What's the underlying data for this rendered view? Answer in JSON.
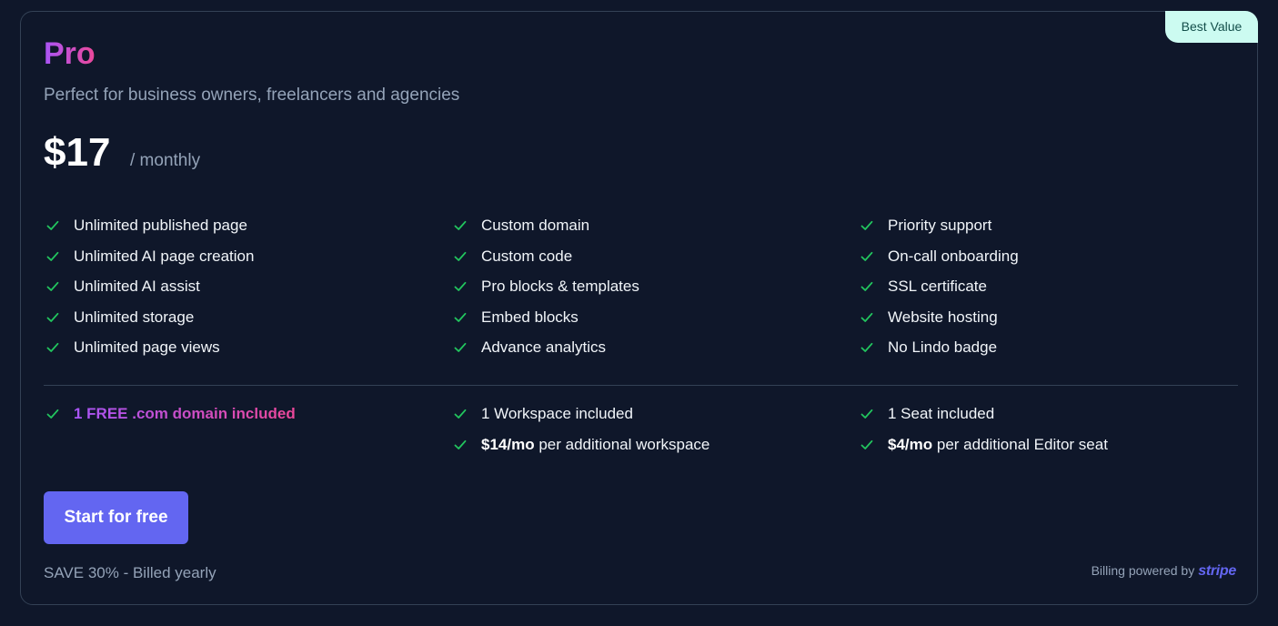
{
  "plan": {
    "badge": "Best Value",
    "name": "Pro",
    "tagline": "Perfect for business owners, freelancers and agencies",
    "price": "$17",
    "period": "/ monthly"
  },
  "features": {
    "col0": [
      "Unlimited published page",
      "Unlimited AI page creation",
      "Unlimited AI assist",
      "Unlimited storage",
      "Unlimited page views"
    ],
    "col1": [
      "Custom domain",
      "Custom code",
      "Pro blocks & templates",
      "Embed blocks",
      "Advance analytics"
    ],
    "col2": [
      "Priority support",
      "On-call onboarding",
      "SSL certificate",
      "Website hosting",
      "No Lindo badge"
    ]
  },
  "extras": {
    "domain": "1 FREE .com domain included",
    "workspace": "1 Workspace included",
    "workspace_price": "$14/mo",
    "workspace_suffix": " per additional workspace",
    "seat": "1 Seat included",
    "seat_price": "$4/mo",
    "seat_suffix": " per additional Editor seat"
  },
  "cta_label": "Start for free",
  "save_note": "SAVE 30% - Billed yearly",
  "billing": {
    "text": "Billing powered by",
    "brand": "stripe"
  },
  "colors": {
    "background": "#0f172a",
    "accent": "#6366f1",
    "check": "#22c55e",
    "badge_bg": "#ccfbf1"
  },
  "icons": {
    "check": "check-icon"
  }
}
